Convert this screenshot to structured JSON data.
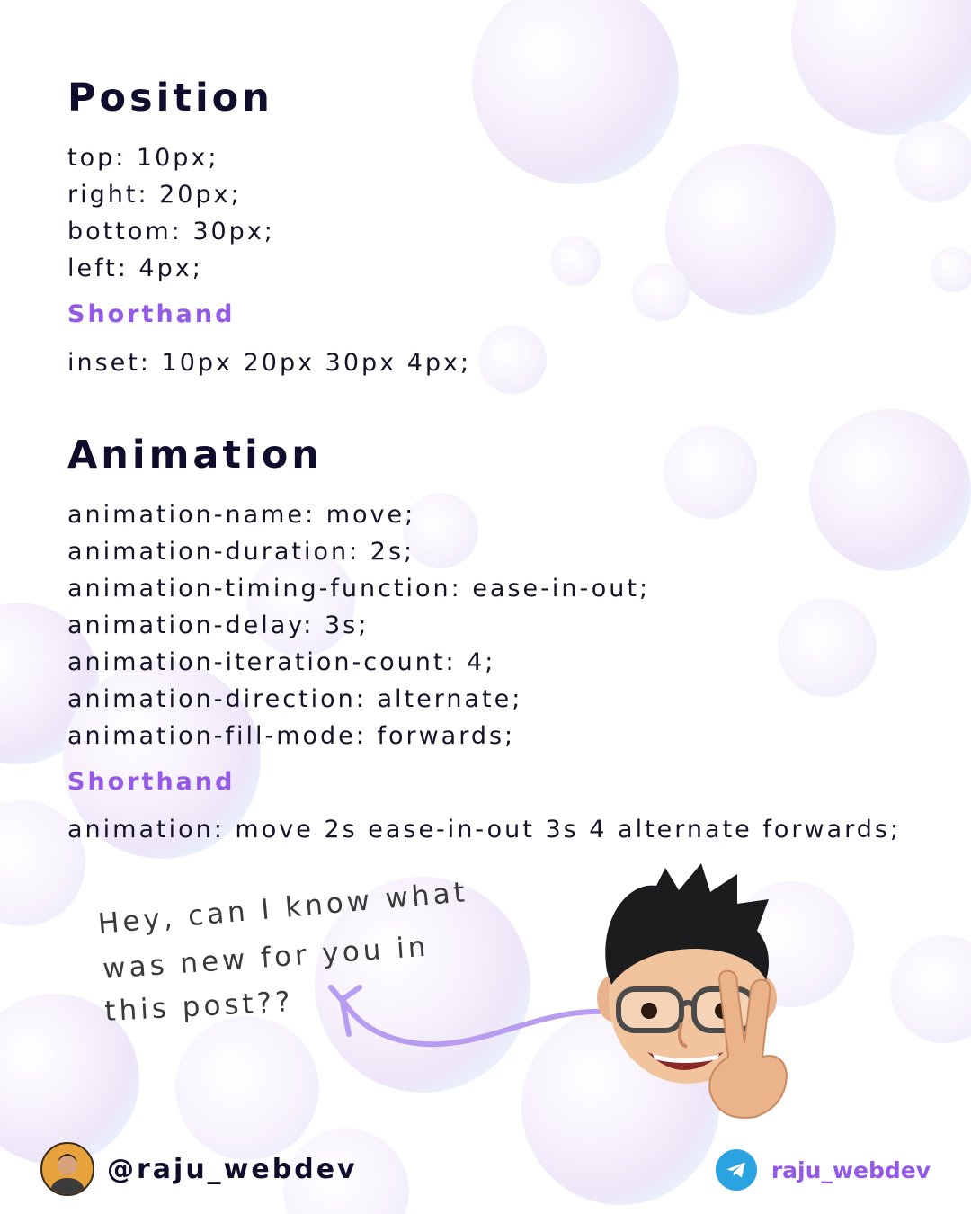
{
  "position": {
    "title": "Position",
    "lines": [
      "top: 10px;",
      "right: 20px;",
      "bottom: 30px;",
      "left: 4px;"
    ],
    "shorthand_label": "Shorthand",
    "shorthand_code": "inset: 10px 20px 30px 4px;"
  },
  "animation": {
    "title": "Animation",
    "lines": [
      "animation-name: move;",
      "animation-duration: 2s;",
      "animation-timing-function: ease-in-out;",
      "animation-delay: 3s;",
      "animation-iteration-count: 4;",
      "animation-direction: alternate;",
      "animation-fill-mode: forwards;"
    ],
    "shorthand_label": "Shorthand",
    "shorthand_code": "animation: move 2s ease-in-out 3s 4 alternate forwards;"
  },
  "note": {
    "lines": [
      "Hey, can I know what",
      "was new for you in",
      "this post??"
    ]
  },
  "footer": {
    "handle": "@raju_webdev",
    "telegram_handle": "raju_webdev"
  },
  "colors": {
    "heading": "#0e0e2c",
    "accent": "#9459e6",
    "telegram": "#2aa3e0"
  },
  "icons": {
    "telegram": "telegram-icon",
    "avatar": "avatar",
    "memoji": "memoji-peace-sign"
  }
}
